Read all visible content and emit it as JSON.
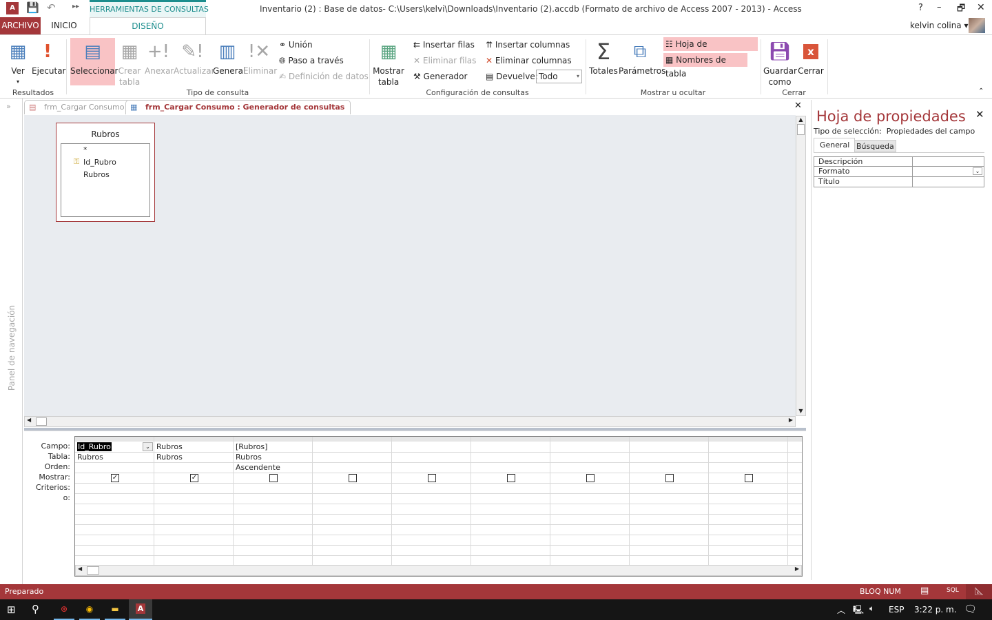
{
  "titlebar": {
    "title": "Inventario (2) : Base de datos- C:\\Users\\kelvi\\Downloads\\Inventario (2).accdb (Formato de archivo de Access 2007 - 2013) - Access",
    "context_tab": "HERRAMIENTAS DE CONSULTAS",
    "help": "?",
    "minimize": "–",
    "restore": "🗗",
    "close": "✕",
    "user": "kelvin colina"
  },
  "tabs": {
    "file": "ARCHIVO",
    "home": "INICIO",
    "design": "DISEÑO"
  },
  "ribbon": {
    "groups": [
      "Resultados",
      "Tipo de consulta",
      "Configuración de consultas",
      "Mostrar u ocultar",
      "Cerrar"
    ],
    "ver": "Ver",
    "ejecutar": "Ejecutar",
    "seleccionar": "Seleccionar",
    "crear": "Crear",
    "tabla": "tabla",
    "anexar": "Anexar",
    "actualizar": "Actualizar",
    "general": "General",
    "eliminar": "Eliminar",
    "union": "Unión",
    "paso": "Paso a través",
    "definicion": "Definición de datos",
    "mostrar": "Mostrar",
    "mostrar2": "tabla",
    "insertar_filas": "Insertar filas",
    "eliminar_filas": "Eliminar filas",
    "generador": "Generador",
    "insertar_columnas": "Insertar columnas",
    "eliminar_columnas": "Eliminar columnas",
    "devuelve": "Devuelve:",
    "devuelve_value": "Todo",
    "totales": "Totales",
    "parametros": "Parámetros",
    "hoja": "Hoja de propiedades",
    "nombres": "Nombres de tabla",
    "guardar": "Guardar",
    "como": "como",
    "cerrar": "Cerrar"
  },
  "nav": {
    "label": "Panel de navegación"
  },
  "doctabs": [
    "frm_Cargar Consumo",
    "frm_Cargar Consumo : Generador de consultas"
  ],
  "fieldlist": {
    "title": "Rubros",
    "fields": [
      "*",
      "Id_Rubro",
      "Rubros"
    ]
  },
  "grid": {
    "row_labels": [
      "Campo:",
      "Tabla:",
      "Orden:",
      "Mostrar:",
      "Criterios:",
      "o:"
    ],
    "columns": [
      {
        "campo": "Id_Rubro",
        "tabla": "Rubros",
        "orden": "",
        "mostrar": true
      },
      {
        "campo": "Rubros",
        "tabla": "Rubros",
        "orden": "",
        "mostrar": true
      },
      {
        "campo": "[Rubros]",
        "tabla": "Rubros",
        "orden": "Ascendente",
        "mostrar": false
      },
      {
        "mostrar": false
      },
      {
        "mostrar": false
      },
      {
        "mostrar": false
      },
      {
        "mostrar": false
      },
      {
        "mostrar": false
      },
      {
        "mostrar": false
      }
    ]
  },
  "props": {
    "title": "Hoja de propiedades",
    "sel_label": "Tipo de selección:",
    "sel_value": "Propiedades del campo",
    "tabs": [
      "General",
      "Búsqueda"
    ],
    "rows": [
      "Descripción",
      "Formato",
      "Título"
    ]
  },
  "status": {
    "text": "Preparado",
    "numlock": "BLOQ NUM",
    "sql": "SQL"
  },
  "taskbar": {
    "lang": "ESP",
    "time": "3:22 p. m."
  },
  "colors": {
    "accent": "#a4373a",
    "highlight": "#f9c3c5",
    "context": "#1b8d8d"
  }
}
